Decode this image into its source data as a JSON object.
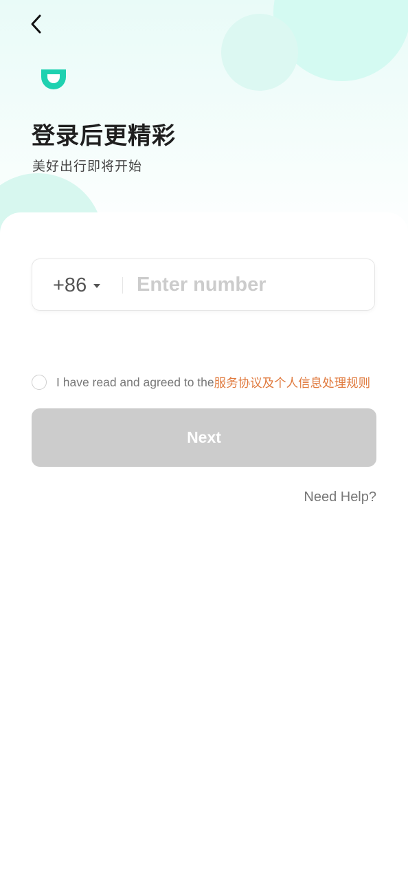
{
  "header": {
    "back_icon": "chevron-left-icon",
    "logo_icon": "didi-logo-icon",
    "title": "登录后更精彩",
    "subtitle": "美好出行即将开始"
  },
  "phone": {
    "country_code": "+86",
    "country_dropdown_icon": "caret-down-icon",
    "placeholder": "Enter number",
    "value": ""
  },
  "agreement": {
    "checked": false,
    "text": "I have read and agreed to the",
    "link": "服务协议及个人信息处理规则"
  },
  "actions": {
    "next_label": "Next",
    "help_label": "Need Help?"
  },
  "colors": {
    "brand": "#1fd1b0",
    "link": "#e07a3e",
    "disabled_button": "#cccccc",
    "hero_bubble": "#d4faf2"
  }
}
